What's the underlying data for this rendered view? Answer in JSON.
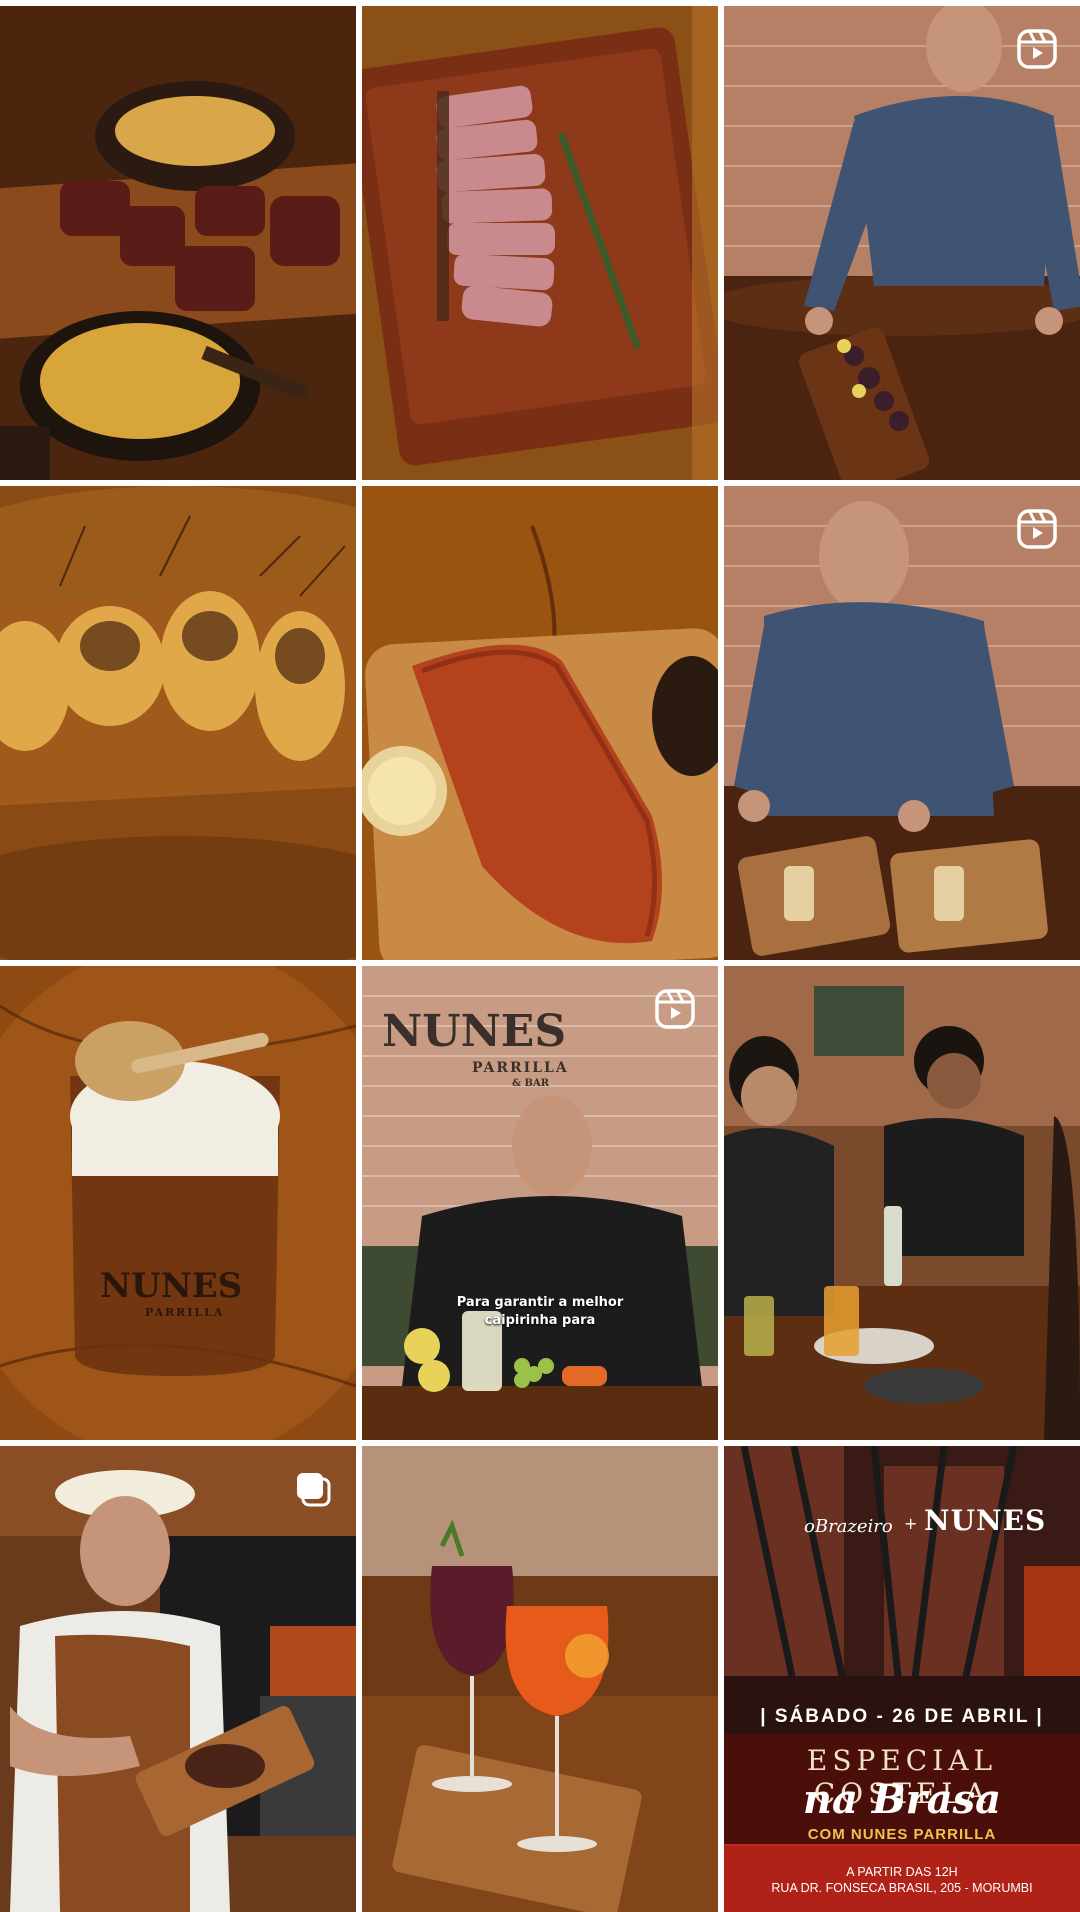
{
  "grid": {
    "posts": [
      {
        "id": "p1",
        "kind": "photo",
        "subject": "picanha-platter-with-farofa"
      },
      {
        "id": "p2",
        "kind": "photo",
        "subject": "sliced-steak-on-board"
      },
      {
        "id": "p3",
        "kind": "reel",
        "icon": "reel-icon",
        "subject": "chef-octopus-board"
      },
      {
        "id": "p4",
        "kind": "photo",
        "subject": "grilled-prawns"
      },
      {
        "id": "p5",
        "kind": "photo",
        "subject": "grilled-salmon"
      },
      {
        "id": "p6",
        "kind": "reel",
        "icon": "reel-icon",
        "subject": "chef-plating-boards"
      },
      {
        "id": "p7",
        "kind": "photo",
        "subject": "cocktail-glass",
        "glass_logo_main": "NUNES",
        "glass_logo_sub": "PARRILLA"
      },
      {
        "id": "p8",
        "kind": "reel",
        "icon": "reel-icon",
        "subject": "chef-caipirinha",
        "wall_logo_main": "NUNES",
        "wall_logo_sub": "PARRILLA",
        "wall_logo_sub2": "& BAR",
        "caption": "Para garantir a melhor caipirinha para"
      },
      {
        "id": "p9",
        "kind": "photo",
        "subject": "diners-at-table"
      },
      {
        "id": "p10",
        "kind": "carousel",
        "icon": "carousel-icon",
        "subject": "chef-with-steak"
      },
      {
        "id": "p11",
        "kind": "photo",
        "subject": "two-cocktails"
      },
      {
        "id": "p12",
        "kind": "photo",
        "subject": "costela-promo",
        "brand_left": "oBrazeiro",
        "brand_plus": "+",
        "brand_right": "NUNES",
        "date": "| SÁBADO - 26 DE ABRIL |",
        "title_line1": "ESPECIAL COSTELA",
        "title_line2": "na Brasa",
        "subtitle": "COM NUNES PARRILLA",
        "footer_line1": "A PARTIR DAS 12H",
        "footer_line2": "RUA DR. FONSECA BRASIL, 205 - MORUMBI"
      }
    ]
  },
  "colors": {
    "wood_dark": "#3b1e0c",
    "wood_mid": "#7a3e14",
    "wood_light": "#b8702c",
    "brick": "#b07a5c",
    "shirt_blue": "#3f5472",
    "promo_red": "#4a0f0a",
    "promo_gold": "#f3c24a"
  }
}
